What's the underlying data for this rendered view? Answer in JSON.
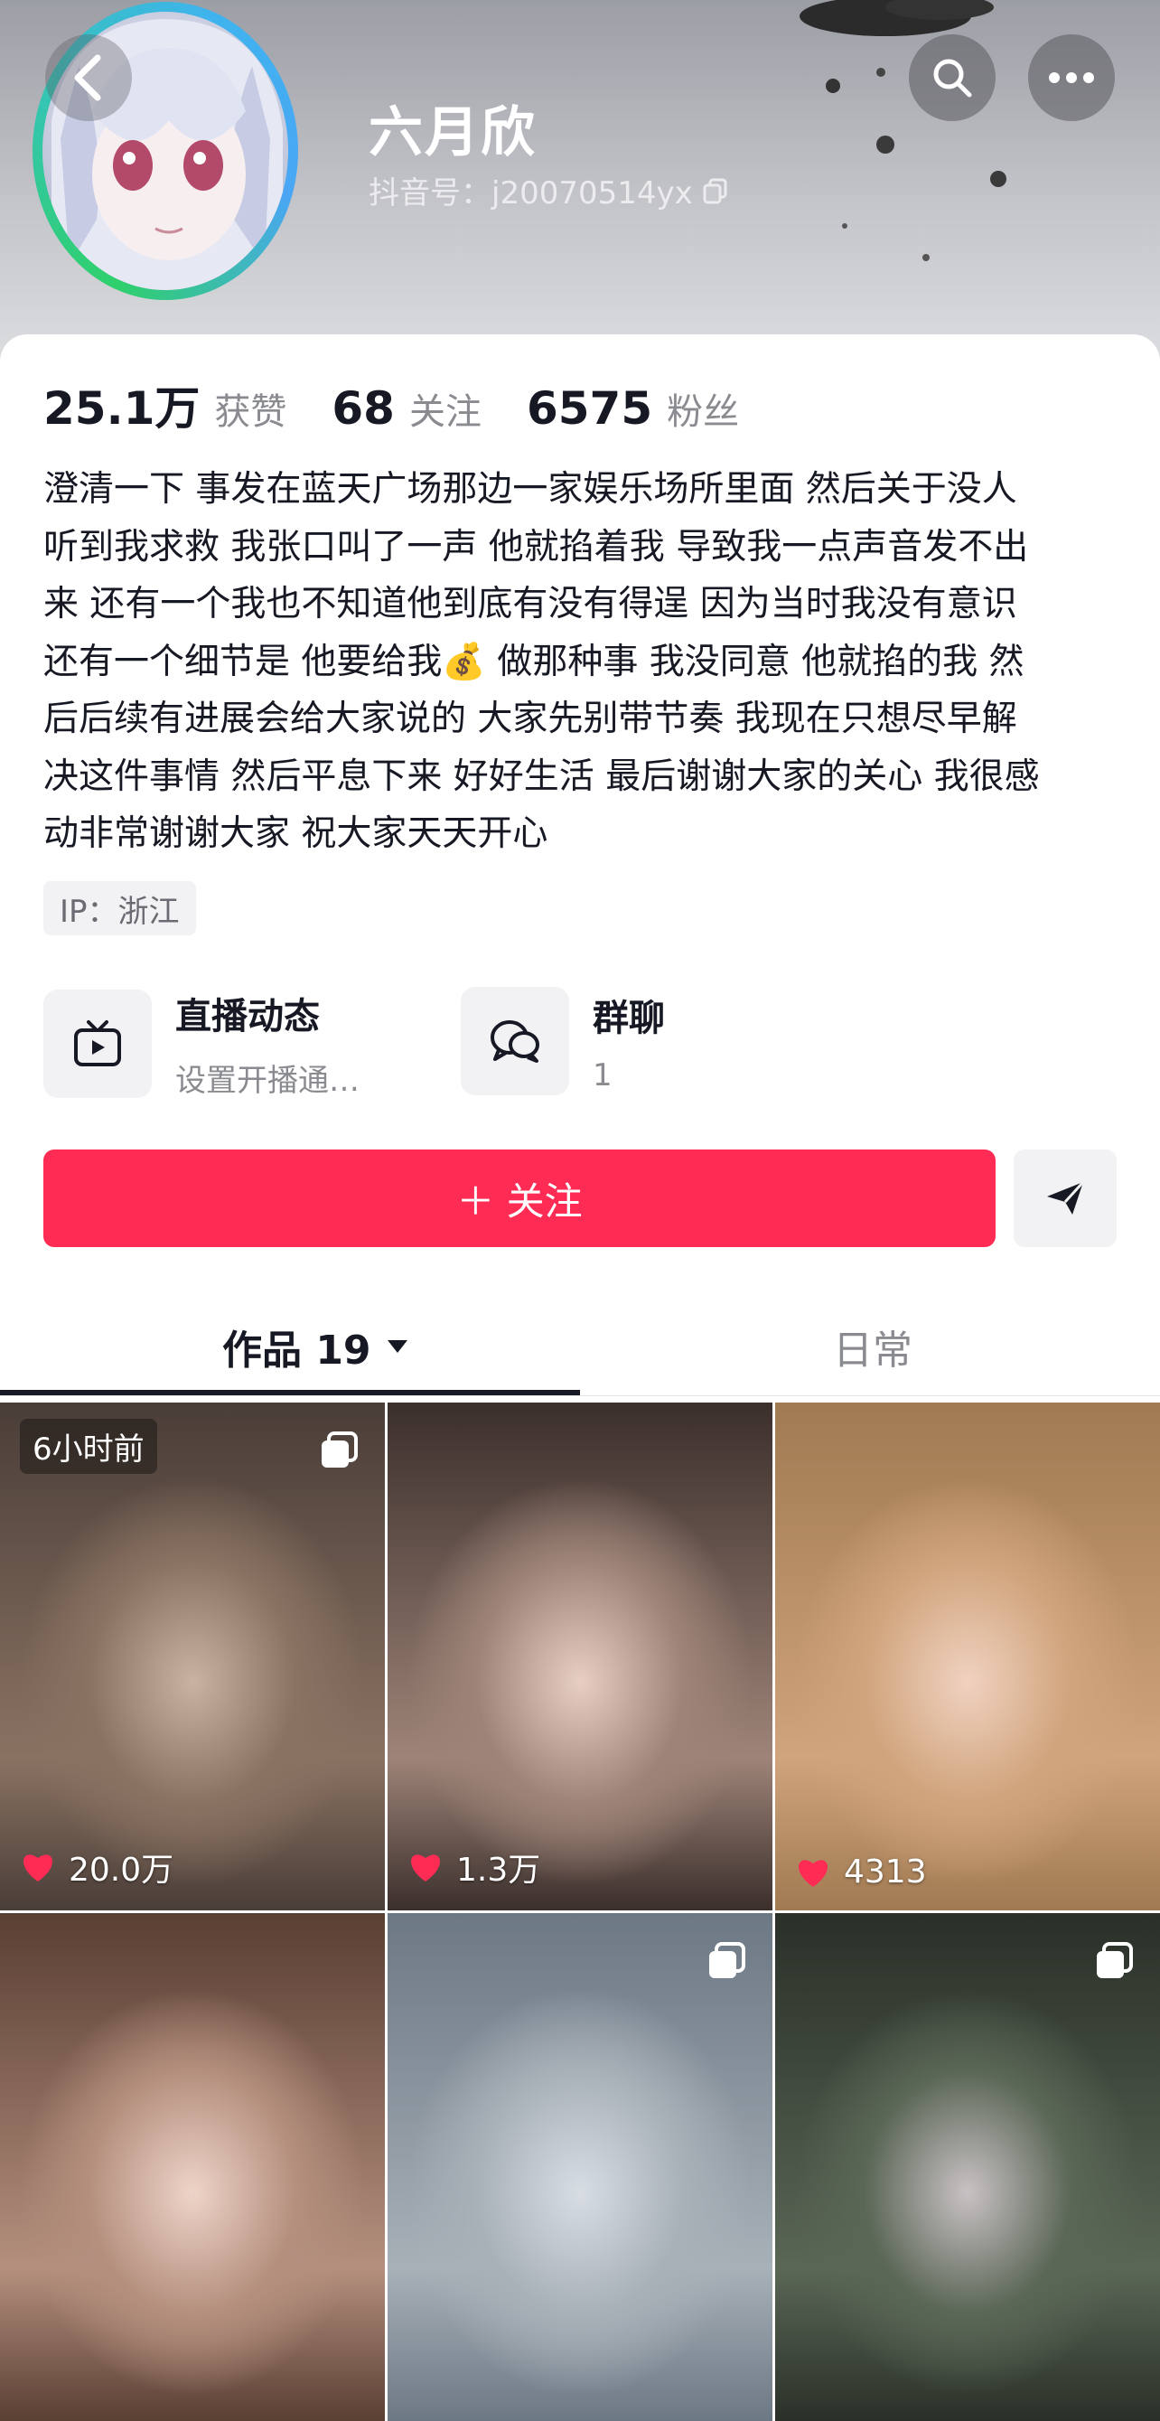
{
  "profile": {
    "name": "六月欣",
    "douyin_id": "抖音号：j20070514yx"
  },
  "stats": [
    {
      "value": "25.1万",
      "label": "获赞"
    },
    {
      "value": "68",
      "label": "关注"
    },
    {
      "value": "6575",
      "label": "粉丝"
    }
  ],
  "bio": [
    "澄清一下 事发在蓝天广场那边一家娱乐场所里面 然后关于没人",
    "听到我求救 我张口叫了一声 他就掐着我 导致我一点声音发不出",
    "来 还有一个我也不知道他到底有没有得逞 因为当时我没有意识",
    "还有一个细节是 他要给我💰 做那种事 我没同意 他就掐的我 然",
    "后后续有进展会给大家说的 大家先别带节奏 我现在只想尽早解",
    "决这件事情 然后平息下来 好好生活 最后谢谢大家的关心 我很感",
    "动非常谢谢大家 祝大家天天开心"
  ],
  "ip_location": "IP：浙江",
  "features": {
    "live": {
      "title": "直播动态",
      "subtitle": "设置开播通…"
    },
    "group_chat": {
      "title": "群聊",
      "subtitle": "1"
    }
  },
  "actions": {
    "follow": "＋ 关注"
  },
  "tabs": {
    "works": "作品 19",
    "daily": "日常"
  },
  "videos": [
    {
      "time": "6小时前",
      "likes": "20.0万",
      "pinned_multi": true,
      "colors": [
        "#4a3e38",
        "#8a7262",
        "#c9b3a0"
      ]
    },
    {
      "time": "",
      "likes": "1.3万",
      "pinned_multi": false,
      "colors": [
        "#3b2f2c",
        "#9e8478",
        "#e8cfc4"
      ]
    },
    {
      "time": "",
      "likes": "4313",
      "pinned_multi": false,
      "colors": [
        "#a07a52",
        "#d0a47c",
        "#f0d2c0"
      ]
    },
    {
      "time": "",
      "likes": "",
      "pinned_multi": false,
      "colors": [
        "#5a3f33",
        "#b48f7e",
        "#eed4c8"
      ]
    },
    {
      "time": "",
      "likes": "",
      "pinned_multi": true,
      "colors": [
        "#6c7884",
        "#a8b0b8",
        "#d8dde4"
      ]
    },
    {
      "time": "",
      "likes": "",
      "pinned_multi": true,
      "colors": [
        "#2a3028",
        "#5a6656",
        "#c9c2c4"
      ]
    }
  ]
}
